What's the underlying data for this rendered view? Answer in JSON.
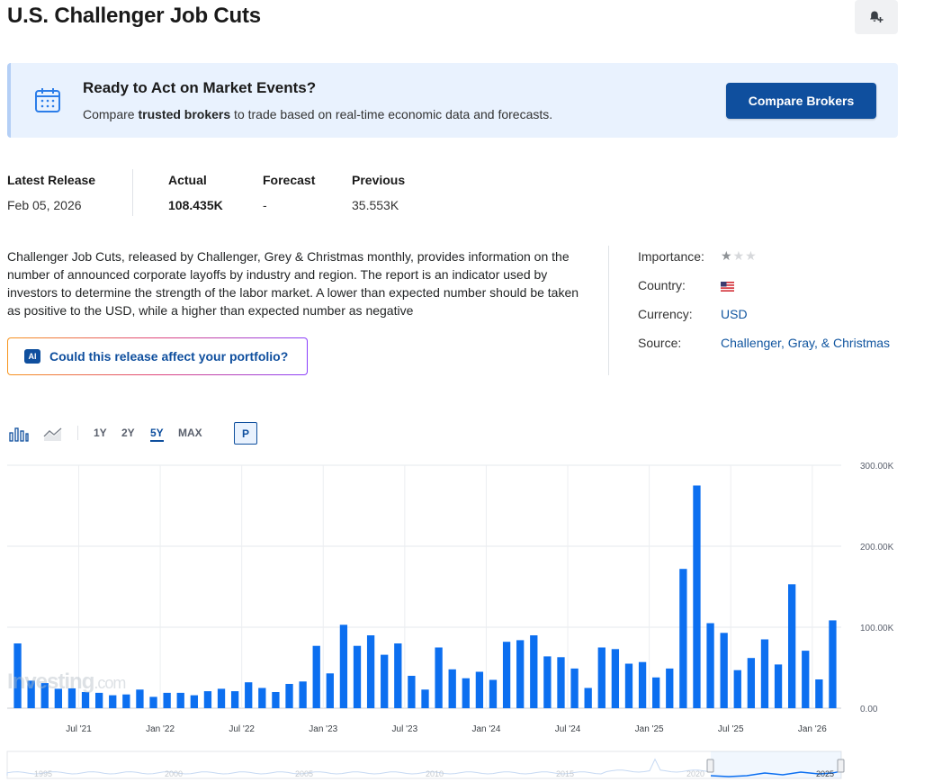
{
  "page": {
    "title": "U.S. Challenger Job Cuts"
  },
  "alert": {
    "icon": "bell-plus-icon"
  },
  "promo": {
    "title": "Ready to Act on Market Events?",
    "text_before": "Compare ",
    "text_bold": "trusted brokers",
    "text_after": " to trade based on real-time economic data and forecasts.",
    "cta": "Compare Brokers",
    "icon": "calendar-icon"
  },
  "release": {
    "latest_label": "Latest Release",
    "latest_value": "Feb 05, 2026",
    "actual_label": "Actual",
    "actual_value": "108.435K",
    "forecast_label": "Forecast",
    "forecast_value": "-",
    "previous_label": "Previous",
    "previous_value": "35.553K"
  },
  "description": "Challenger Job Cuts, released by Challenger, Grey & Christmas monthly, provides information on the number of announced corporate layoffs by industry and region. The report is an indicator used by investors to determine the strength of the labor market. A lower than expected number should be taken as positive to the USD, while a higher than expected number as negative",
  "ai": {
    "badge": "AI",
    "label": "Could this release affect your portfolio?"
  },
  "meta": {
    "importance_label": "Importance:",
    "importance_stars": 1,
    "importance_max": 3,
    "country_label": "Country:",
    "country_flag": "us-flag-icon",
    "currency_label": "Currency:",
    "currency_value": "USD",
    "source_label": "Source:",
    "source_value": "Challenger, Gray, & Christmas"
  },
  "chart_tools": {
    "bar_icon": "bar-chart-icon",
    "line_icon": "line-chart-icon",
    "ranges": [
      "1Y",
      "2Y",
      "5Y",
      "MAX"
    ],
    "active_range": "5Y",
    "p_label": "P"
  },
  "watermark": {
    "brand": "Investing",
    "suffix": ".com"
  },
  "chart_data": {
    "type": "bar",
    "color": "#0c6ff0",
    "y_ticks": [
      "300.00K",
      "200.00K",
      "100.00K",
      "0.00"
    ],
    "y_tick_values": [
      300000,
      200000,
      100000,
      0
    ],
    "ylim": [
      0,
      300000
    ],
    "x_tick_labels": [
      "Jul '21",
      "Jan '22",
      "Jul '22",
      "Jan '23",
      "Jul '23",
      "Jan '24",
      "Jul '24",
      "Jan '25",
      "Jul '25",
      "Jan '26"
    ],
    "x_tick_bar_index": [
      5,
      11,
      17,
      23,
      29,
      35,
      41,
      47,
      53,
      59
    ],
    "values": [
      80000,
      34000,
      31000,
      24000,
      24500,
      20000,
      19000,
      16000,
      17000,
      23000,
      14000,
      19000,
      19000,
      16000,
      21000,
      24000,
      21000,
      32000,
      25000,
      20000,
      30000,
      33000,
      77000,
      43000,
      103000,
      77000,
      90000,
      66000,
      80000,
      40000,
      23000,
      75000,
      48000,
      37000,
      45000,
      35000,
      82000,
      84000,
      90000,
      64000,
      63000,
      49000,
      25000,
      75000,
      73000,
      55000,
      57000,
      38000,
      49000,
      172000,
      275000,
      105000,
      93000,
      47000,
      62000,
      85000,
      54000,
      153000,
      71000,
      35553,
      108435
    ]
  },
  "navigator": {
    "labels": [
      "1995",
      "2000",
      "2005",
      "2010",
      "2015",
      "2020",
      "2025"
    ]
  }
}
